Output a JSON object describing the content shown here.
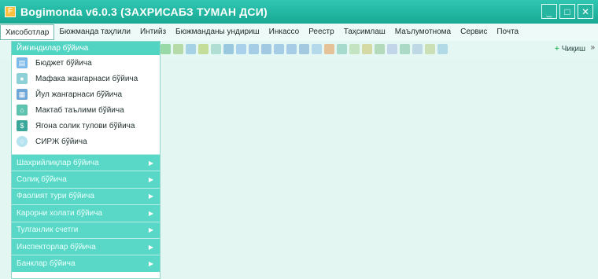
{
  "window": {
    "title": "Bogimonda v6.0.3 (ЗАХРИСАБЗ ТУМАН ДСИ)",
    "controls": [
      "_",
      "□",
      "✕"
    ]
  },
  "menu": [
    "Хисоботлар",
    "Бюжманда таҳлили",
    "Интийз",
    "Бюжманданы ундириш",
    "Инкассо",
    "Реестр",
    "Таҳсимлаш",
    "Маълумотнома",
    "Сервис",
    "Почта"
  ],
  "toolbar": {
    "right_label": "Чиқиш",
    "more": "»"
  },
  "dropdown": {
    "header": "Йиғиндилар бўйича",
    "items": [
      {
        "label": "Бюджет бўйича",
        "icon": "document-icon"
      },
      {
        "label": "Мафака жангарнаси бўйича",
        "icon": "person-icon"
      },
      {
        "label": "Йул жангарнаси бўйича",
        "icon": "table-icon"
      },
      {
        "label": "Мактаб таълими бўйича",
        "icon": "school-icon"
      },
      {
        "label": "Ягона солик тулови бўйича",
        "icon": "tax-icon"
      },
      {
        "label": "СИРЖ бўйича",
        "icon": "circle-icon"
      }
    ],
    "submenus": [
      "Шахрийлиқлар бўйича",
      "Солиқ бўйича",
      "Фаолият тури бўйича",
      "Карорни холати бўйича",
      "Тулганлик счетги",
      "Инспекторлар бўйича",
      "Банклар бўйича"
    ]
  }
}
